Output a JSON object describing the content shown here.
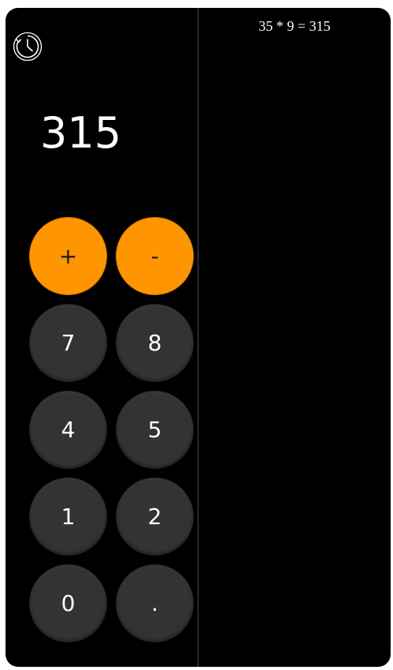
{
  "calculator": {
    "display_value": "315",
    "keys": {
      "plus": "+",
      "minus": "-",
      "seven": "7",
      "eight": "8",
      "four": "4",
      "five": "5",
      "one": "1",
      "two": "2",
      "zero": "0",
      "decimal": "."
    },
    "icons": {
      "history": "history-clock-icon"
    },
    "colors": {
      "operator_key": "#ff9500",
      "number_key": "#333333",
      "background": "#000000"
    }
  },
  "history": {
    "entries": [
      "35 * 9 = 315"
    ]
  }
}
